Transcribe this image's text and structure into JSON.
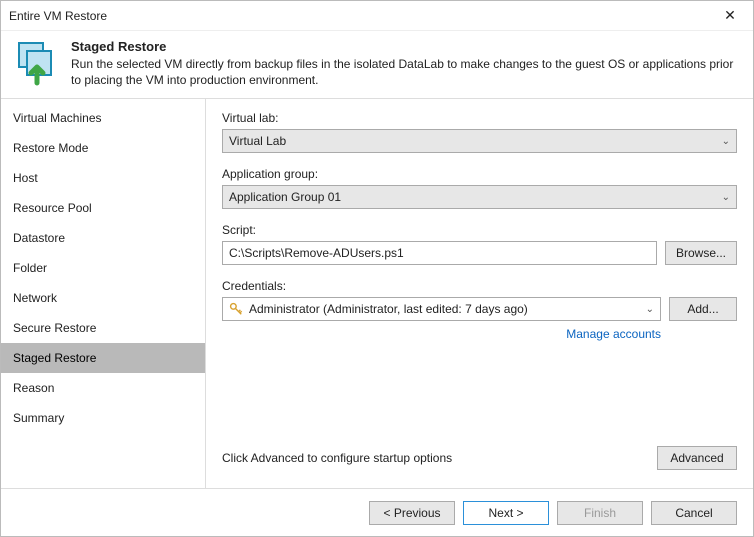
{
  "window": {
    "title": "Entire VM Restore"
  },
  "header": {
    "title": "Staged Restore",
    "subtitle": "Run the selected VM directly from backup files in the isolated DataLab to make changes to the guest OS or applications prior to placing the VM into production environment."
  },
  "sidebar": {
    "items": [
      {
        "label": "Virtual Machines"
      },
      {
        "label": "Restore Mode"
      },
      {
        "label": "Host"
      },
      {
        "label": "Resource Pool"
      },
      {
        "label": "Datastore"
      },
      {
        "label": "Folder"
      },
      {
        "label": "Network"
      },
      {
        "label": "Secure Restore"
      },
      {
        "label": "Staged Restore"
      },
      {
        "label": "Reason"
      },
      {
        "label": "Summary"
      }
    ],
    "selected_index": 8
  },
  "form": {
    "virtual_lab": {
      "label": "Virtual lab:",
      "value": "Virtual Lab"
    },
    "app_group": {
      "label": "Application group:",
      "value": "Application Group 01"
    },
    "script": {
      "label": "Script:",
      "value": "C:\\Scripts\\Remove-ADUsers.ps1",
      "browse_label": "Browse..."
    },
    "credentials": {
      "label": "Credentials:",
      "value": "Administrator (Administrator, last edited: 7 days ago)",
      "add_label": "Add..."
    },
    "manage_accounts_label": "Manage accounts",
    "advanced_hint": "Click Advanced to configure startup options",
    "advanced_label": "Advanced"
  },
  "footer": {
    "previous_label": "< Previous",
    "next_label": "Next >",
    "finish_label": "Finish",
    "cancel_label": "Cancel"
  }
}
